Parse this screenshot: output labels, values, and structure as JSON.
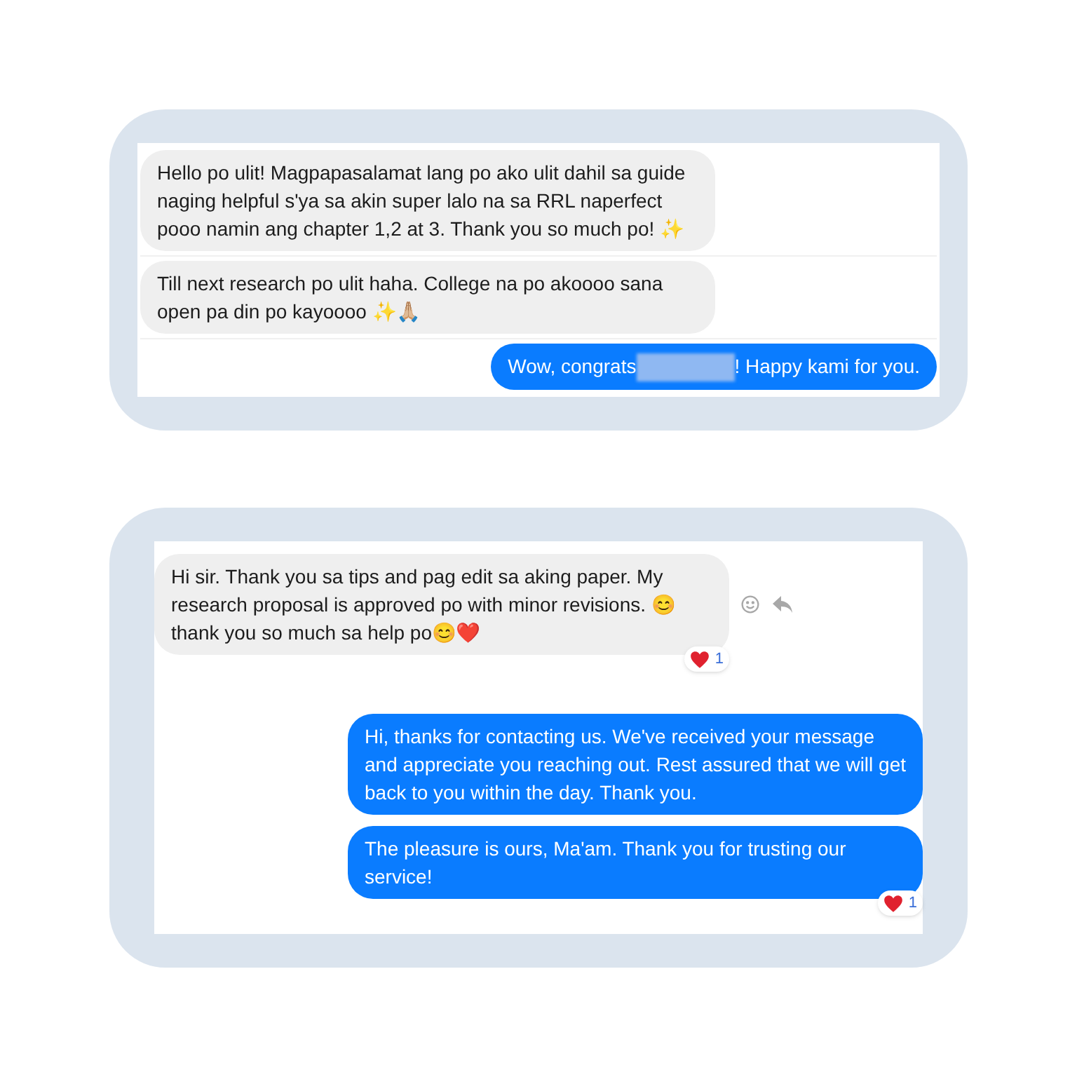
{
  "panels": [
    {
      "messages": [
        {
          "kind": "incoming",
          "text": "Hello po ulit! Magpapasalamat lang po ako ulit dahil sa guide naging helpful s'ya sa akin super lalo na sa RRL naperfect pooo namin ang chapter 1,2 at 3. Thank you so much po! ✨"
        },
        {
          "kind": "incoming",
          "text": "Till next research po ulit haha. College na po akoooo sana open pa din po kayoooo ✨🙏🏼"
        },
        {
          "kind": "outgoing",
          "text_before": "Wow, congrats",
          "redacted": true,
          "text_after": "! Happy kami for you."
        }
      ]
    },
    {
      "messages": [
        {
          "kind": "incoming",
          "text": "Hi sir. Thank you sa tips and pag edit sa aking paper. My research proposal is approved po with minor revisions. 😊 thank you so much sa help po😊❤️",
          "actions": true,
          "reaction": {
            "count": "1"
          }
        },
        {
          "kind": "outgoing",
          "text": "Hi, thanks for contacting us. We've received your message and appreciate you reaching out. Rest assured that we will get back to you within the day. Thank you."
        },
        {
          "kind": "outgoing",
          "text": "The pleasure is ours, Ma'am. Thank you for trusting our service!",
          "reaction": {
            "count": "1"
          }
        }
      ]
    }
  ]
}
